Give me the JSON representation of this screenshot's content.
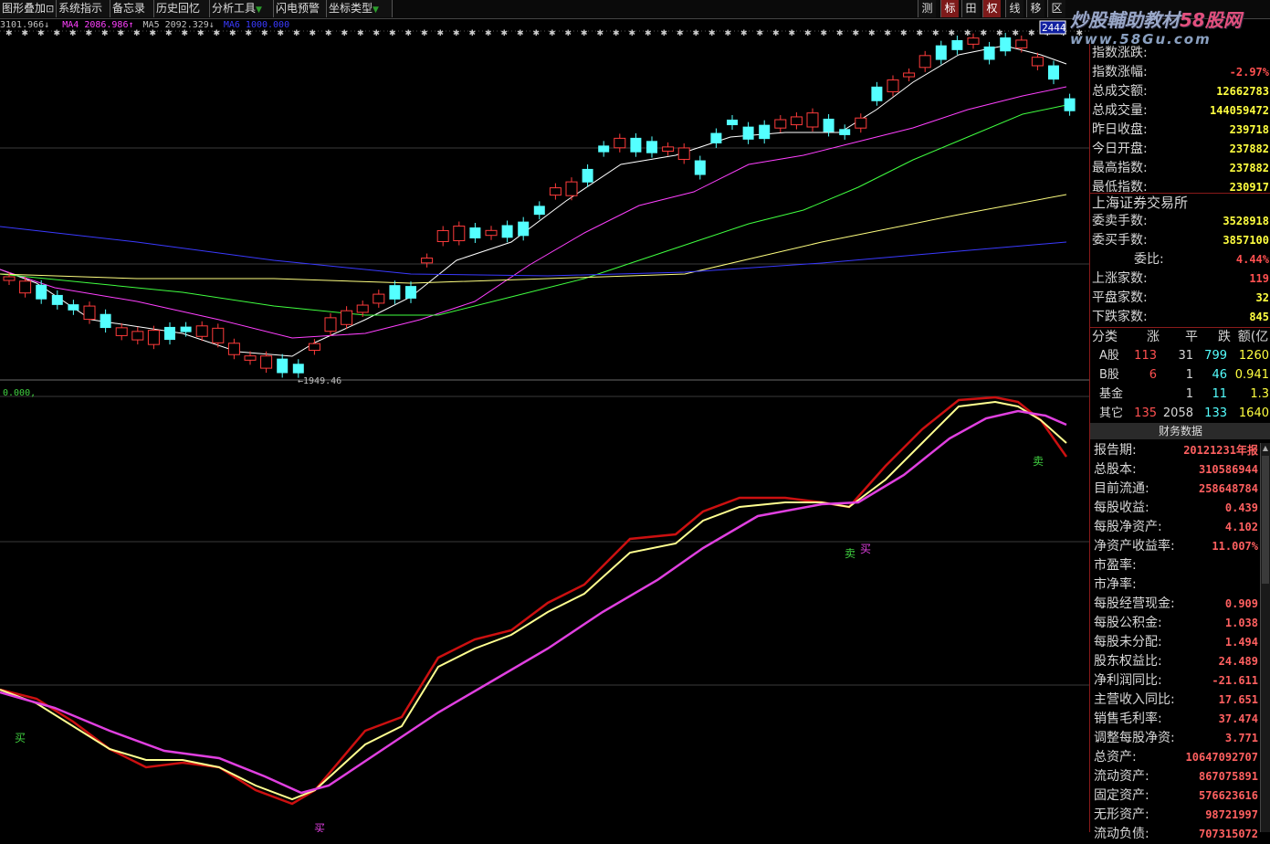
{
  "toolbar": {
    "items": [
      "图形叠加",
      "系统指示",
      "备忘录",
      "历史回忆",
      "分析工具",
      "闪电预警",
      "坐标类型"
    ],
    "right_buttons": [
      "测",
      "标",
      "田",
      "权",
      "线",
      "移",
      "区"
    ]
  },
  "watermark": {
    "line1_a": "炒股輔助教材",
    "line1_b": "58股网",
    "line2": "www.58Gu.com"
  },
  "ma_bar": {
    "ma3": "3101.966↓",
    "ma4_label": "MA4",
    "ma4": "2086.986↑",
    "ma5_label": "MA5",
    "ma5": "2092.329↓",
    "ma6": "MA6 1000.000"
  },
  "price_label": "2444",
  "low_label": "←1949.46",
  "indicator_label": "0.000,",
  "signals": [
    "买",
    "卖",
    "买",
    "卖",
    "买"
  ],
  "colors": {
    "up": "#ff3b3b",
    "down": "#54ffff",
    "ma1": "#ffffff",
    "ma2": "#ff40ff",
    "ma3": "#40ff40",
    "ma4": "#ffff80",
    "ma5": "#3a3aff",
    "line_red": "#cc1010",
    "line_yellow": "#ffff90",
    "line_magenta": "#e040e0",
    "panel_red": "#ff5050",
    "panel_yellow": "#ffff40"
  },
  "index_info": [
    {
      "label": "指数涨跌:",
      "value": ""
    },
    {
      "label": "指数涨幅:",
      "value": "-2.97%"
    },
    {
      "label": "总成交额:",
      "value": "12662783"
    },
    {
      "label": "总成交量:",
      "value": "144059472"
    },
    {
      "label": "昨日收盘:",
      "value": "239718"
    },
    {
      "label": "今日开盘:",
      "value": "237882"
    },
    {
      "label": "最高指数:",
      "value": "237882"
    },
    {
      "label": "最低指数:",
      "value": "230917"
    }
  ],
  "exchange": "上海证券交易所",
  "market_info": [
    {
      "label": "委卖手数:",
      "value": "3528918"
    },
    {
      "label": "委买手数:",
      "value": "3857100"
    },
    {
      "label": "委比:",
      "value": "4.44%"
    },
    {
      "label": "上涨家数:",
      "value": "119"
    },
    {
      "label": "平盘家数:",
      "value": "32"
    },
    {
      "label": "下跌家数:",
      "value": "845"
    }
  ],
  "category_table": {
    "headers": [
      "分类",
      "涨",
      "平",
      "跌",
      "额(亿"
    ],
    "rows": [
      [
        "A股",
        "113",
        "31",
        "799",
        "1260"
      ],
      [
        "B股",
        "6",
        "1",
        "46",
        "0.941"
      ],
      [
        "基金",
        "",
        "1",
        "11",
        "1.3"
      ],
      [
        "其它",
        "135",
        "2058",
        "133",
        "1640"
      ]
    ]
  },
  "financial_title": "财务数据",
  "financial": [
    {
      "label": "报告期:",
      "value": "20121231年报"
    },
    {
      "label": "总股本:",
      "value": "310586944"
    },
    {
      "label": "目前流通:",
      "value": "258648784"
    },
    {
      "label": "每股收益:",
      "value": "0.439"
    },
    {
      "label": "每股净资产:",
      "value": "4.102"
    },
    {
      "label": "净资产收益率:",
      "value": "11.007%"
    },
    {
      "label": "市盈率:",
      "value": ""
    },
    {
      "label": "市净率:",
      "value": ""
    },
    {
      "label": "每股经营现金:",
      "value": "0.909"
    },
    {
      "label": "每股公积金:",
      "value": "1.038"
    },
    {
      "label": "每股未分配:",
      "value": "1.494"
    },
    {
      "label": "股东权益比:",
      "value": "24.489"
    },
    {
      "label": "净利润同比:",
      "value": "-21.611"
    },
    {
      "label": "主营收入同比:",
      "value": "17.651"
    },
    {
      "label": "销售毛利率:",
      "value": "37.474"
    },
    {
      "label": "调整每股净资:",
      "value": "3.771"
    },
    {
      "label": "总资产:",
      "value": "10647092707"
    },
    {
      "label": "流动资产:",
      "value": "867075891"
    },
    {
      "label": "固定资产:",
      "value": "576623616"
    },
    {
      "label": "无形资产:",
      "value": "98721997"
    },
    {
      "label": "流动负债:",
      "value": "707315072"
    }
  ]
}
